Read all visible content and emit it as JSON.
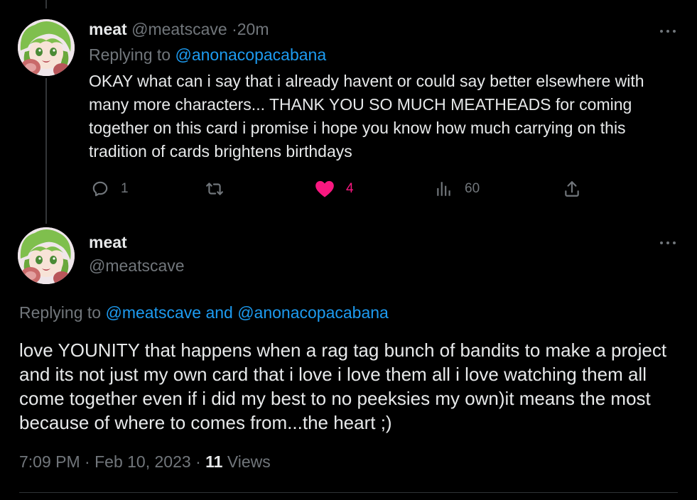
{
  "colors": {
    "background": "#000000",
    "text_primary": "#e7e9ea",
    "text_secondary": "#71767b",
    "link": "#1d9bf0",
    "like": "#f91880"
  },
  "reply_tweet": {
    "name": "meat",
    "handle": "@meatscave",
    "separator": "·",
    "time": "20m",
    "replying_prefix": "Replying to",
    "replying_to": "@anonacopacabana",
    "text": "OKAY what can i say that i already havent or could say better elsewhere with many more characters... THANK YOU SO MUCH MEATHEADS for coming together on this card i promise i hope you know how much carrying on this tradition of cards brightens birthdays",
    "actions": {
      "reply": {
        "icon": "reply-icon",
        "count": "1"
      },
      "retweet": {
        "icon": "retweet-icon",
        "count": ""
      },
      "like": {
        "icon": "heart-filled-icon",
        "count": "4",
        "liked": true
      },
      "views": {
        "icon": "analytics-icon",
        "count": "60"
      },
      "share": {
        "icon": "share-icon"
      }
    }
  },
  "main_tweet": {
    "name": "meat",
    "handle": "@meatscave",
    "replying_prefix": "Replying to",
    "replying_to_1": "@meatscave",
    "replying_and": "and",
    "replying_to_2": "@anonacopacabana",
    "text": "love YOUNITY that happens when a rag tag bunch of bandits to make a project and its not just my own card that i love i love them all i love watching them all come together even if i did my best to no peeksies my own)it means the most because of where to comes from...the heart ;)",
    "time": "7:09 PM",
    "date": "Feb 10, 2023",
    "separator": "·",
    "views_count": "11",
    "views_label": "Views"
  }
}
